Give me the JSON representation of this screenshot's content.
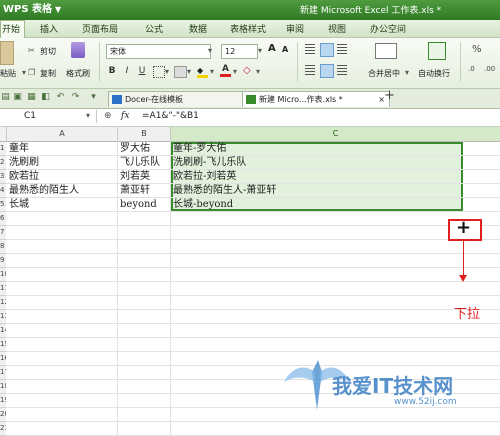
{
  "app": {
    "name": "WPS 表格",
    "doc_title": "新建 Microsoft Excel 工作表.xls *"
  },
  "menu": [
    "开始",
    "插入",
    "页面布局",
    "公式",
    "数据",
    "表格样式",
    "审阅",
    "视图",
    "办公空间"
  ],
  "ribbon": {
    "cut": "剪切",
    "copy": "复制",
    "format_painter": "格式刷",
    "paste": "粘贴",
    "font_name": "宋体",
    "font_size": "12",
    "merge_center": "合并居中",
    "auto_wrap": "自动换行",
    "font_color_letter": "A",
    "size_up": "A",
    "size_down": "A",
    "bold": "B",
    "italic": "I",
    "underline": "U",
    "percent": "%",
    "decimal_1": ".0",
    "decimal_2": ".00"
  },
  "tabs": [
    {
      "label": "Docer-在线模板"
    },
    {
      "label": "新建 Micro...作表.xls *"
    }
  ],
  "formula_bar": {
    "name_box": "C1",
    "fx": "fx",
    "formula": "=A1&\"-\"&B1"
  },
  "sheet": {
    "columns": [
      "A",
      "B",
      "C"
    ],
    "rows": [
      "1",
      "2",
      "3",
      "4",
      "5",
      "6",
      "7",
      "8",
      "9",
      "10",
      "11",
      "12",
      "13",
      "14",
      "15",
      "16",
      "17",
      "18",
      "19",
      "20",
      "21"
    ],
    "cells_a": [
      "童年",
      "洗刷刷",
      "欧若拉",
      "最熟悉的陌生人",
      "长城"
    ],
    "cells_b": [
      "罗大佑",
      "飞儿乐队",
      "刘若英",
      "萧亚轩",
      "beyond"
    ],
    "cells_c": [
      "童年-罗大佑",
      "洗刷刷-飞儿乐队",
      "欧若拉-刘若英",
      "最熟悉的陌生人-萧亚轩",
      "长城-beyond"
    ]
  },
  "annotation": {
    "handle_symbol": "+",
    "label": "下拉"
  },
  "watermark": {
    "text": "我爱IT技术网",
    "url": "www.52ij.com"
  },
  "colors": {
    "accent": "#3a8a2e",
    "selection": "#dfeed7",
    "annotation": "#e02020"
  }
}
